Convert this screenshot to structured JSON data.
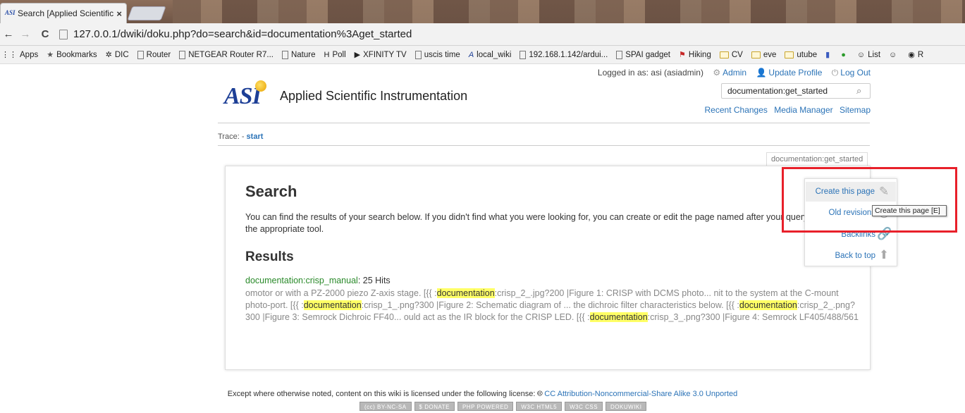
{
  "browser": {
    "tab_title": "Search [Applied Scientific I",
    "tab_close": "×",
    "favicon": "ASI",
    "url": "127.0.0.1/dwiki/doku.php?do=search&id=documentation%3Aget_started",
    "back": "←",
    "forward": "→",
    "reload": "C"
  },
  "bookmarks": [
    {
      "label": "Apps",
      "icon": "apps-icon"
    },
    {
      "label": "Bookmarks",
      "icon": "star-icon"
    },
    {
      "label": "DIC",
      "icon": "sparkle-icon"
    },
    {
      "label": "Router",
      "icon": "page-icon"
    },
    {
      "label": "NETGEAR Router R7...",
      "icon": "page-icon"
    },
    {
      "label": "Nature",
      "icon": "page-icon"
    },
    {
      "label": "Poll",
      "icon": "poll-icon"
    },
    {
      "label": "XFINITY TV",
      "icon": "tv-icon"
    },
    {
      "label": "uscis time",
      "icon": "page-icon"
    },
    {
      "label": "local_wiki",
      "icon": "asi-icon"
    },
    {
      "label": "192.168.1.142/ardui...",
      "icon": "page-icon"
    },
    {
      "label": "SPAI gadget",
      "icon": "page-icon"
    },
    {
      "label": "Hiking",
      "icon": "pin-icon"
    },
    {
      "label": "CV",
      "icon": "folder-icon"
    },
    {
      "label": "eve",
      "icon": "folder-icon"
    },
    {
      "label": "utube",
      "icon": "folder-icon"
    },
    {
      "label": "",
      "icon": "chart-icon"
    },
    {
      "label": "",
      "icon": "green-icon"
    },
    {
      "label": "List",
      "icon": "list-icon"
    },
    {
      "label": "",
      "icon": "list-icon"
    },
    {
      "label": "R",
      "icon": "chrome-icon"
    }
  ],
  "userbar": {
    "logged_in": "Logged in as: asi (asiadmin)",
    "admin": "Admin",
    "update_profile": "Update Profile",
    "logout": "Log Out"
  },
  "site": {
    "name": "Applied Scientific Instrumentation",
    "logo_text": "ASI",
    "search_value": "documentation:get_started"
  },
  "sitetools": {
    "recent_changes": "Recent Changes",
    "media_manager": "Media Manager",
    "sitemap": "Sitemap"
  },
  "trace": {
    "label": "Trace:",
    "sep": " - ",
    "link": "start"
  },
  "page_id": "documentation:get_started",
  "content": {
    "title": "Search",
    "intro": "You can find the results of your search below. If you didn't find what you were looking for, you can create or edit the page named after your query with the appropriate tool.",
    "results_heading": "Results",
    "hit_link": "documentation:crisp_manual",
    "hit_count": ": 25 Hits",
    "snippet": [
      {
        "t": "omotor or with a PZ-2000 piezo Z-axis stage. [{{ :",
        "h": false
      },
      {
        "t": "documentation",
        "h": true
      },
      {
        "t": ":crisp_2_.jpg?200 |Figure 1: CRISP with DCMS photo... nit to the system at the C-mount photo-port. [{{ :",
        "h": false
      },
      {
        "t": "documentation",
        "h": true
      },
      {
        "t": ":crisp_1_.png?300 |Figure 2: Schematic diagram of ... the dichroic filter characteristics below. [{{ :",
        "h": false
      },
      {
        "t": "documentation",
        "h": true
      },
      {
        "t": ":crisp_2_.png?300 |Figure 3: Semrock Dichroic FF40... ould act as the IR block for the CRISP LED. [{{ :",
        "h": false
      },
      {
        "t": "documentation",
        "h": true
      },
      {
        "t": ":crisp_3_.png?300 |Figure 4: Semrock LF405/488/561",
        "h": false
      }
    ]
  },
  "pagetools": {
    "create": "Create this page",
    "old_revisions": "Old revisions",
    "backlinks": "Backlinks",
    "back_to_top": "Back to top"
  },
  "tooltip": "Create this page [E]",
  "footer": {
    "text": "Except where otherwise noted, content on this wiki is licensed under the following license:",
    "license": "CC Attribution-Noncommercial-Share Alike 3.0 Unported",
    "badges": [
      "(cc) BY-NC-SA",
      "$ DONATE",
      "PHP POWERED",
      "W3C HTML5",
      "W3C CSS",
      "DOKUWIKI"
    ]
  },
  "colors": {
    "link": "#2b73b7",
    "highlight": "#ffff66",
    "annotation": "#e8202a",
    "hit_link": "#2a8a2a"
  }
}
